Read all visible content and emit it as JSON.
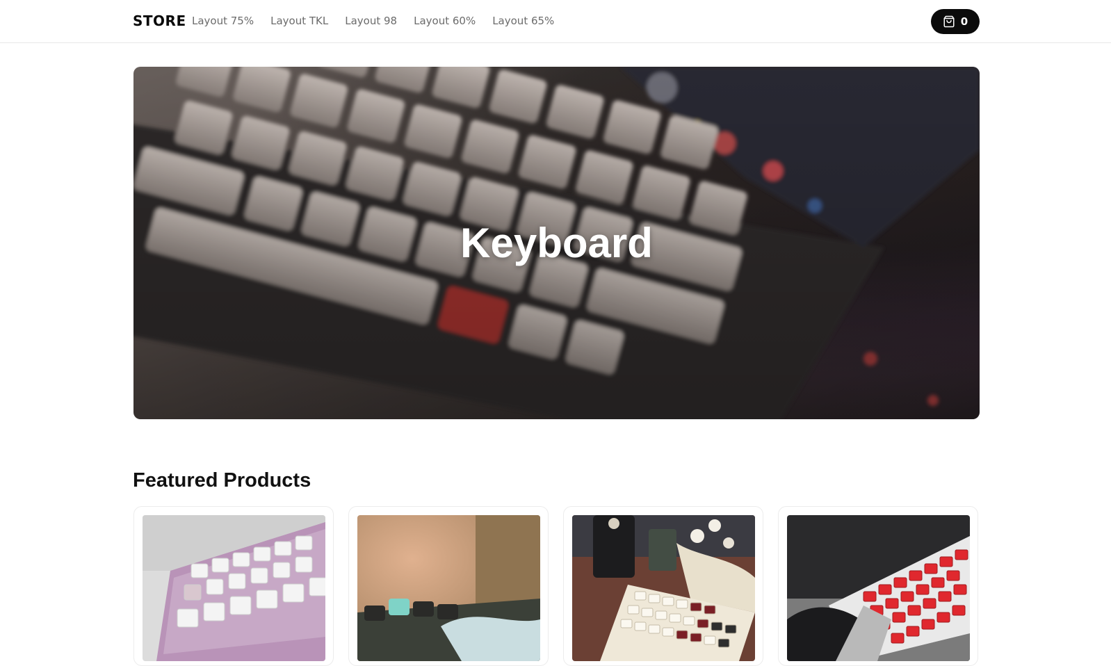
{
  "header": {
    "brand": "STORE",
    "nav": [
      {
        "label": "Layout 75%"
      },
      {
        "label": "Layout TKL"
      },
      {
        "label": "Layout 98"
      },
      {
        "label": "Layout 60%"
      },
      {
        "label": "Layout 65%"
      }
    ],
    "cart": {
      "icon": "shopping-bag-icon",
      "count": "0"
    }
  },
  "hero": {
    "title": "Keyboard",
    "image": "blurred-mechanical-keyboard-photo"
  },
  "featured": {
    "title": "Featured Products",
    "products": [
      {
        "image": "pink-keyboard-white-keycaps-photo"
      },
      {
        "image": "keyboard-with-teal-keycap-and-cat-photo"
      },
      {
        "image": "cream-red-keyboard-with-candle-photo"
      },
      {
        "image": "red-keycaps-keyboard-photo"
      }
    ]
  }
}
